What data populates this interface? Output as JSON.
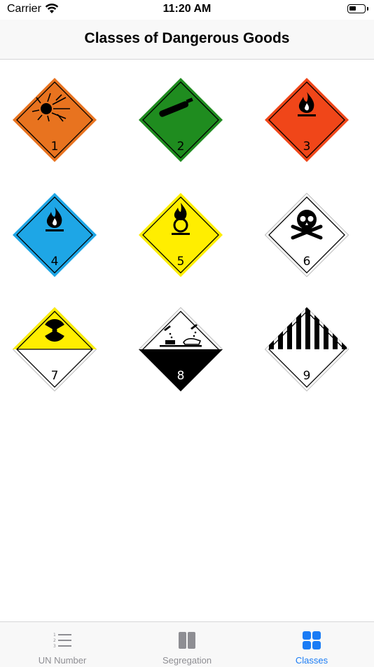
{
  "status_bar": {
    "carrier": "Carrier",
    "time": "11:20 AM"
  },
  "nav": {
    "title": "Classes of Dangerous Goods"
  },
  "classes": [
    {
      "number": "1",
      "color": "#e8731f",
      "symbol": "exploding-bomb-icon"
    },
    {
      "number": "2",
      "color": "#1f8c1f",
      "symbol": "gas-cylinder-icon"
    },
    {
      "number": "3",
      "color": "#f04619",
      "symbol": "flame-icon"
    },
    {
      "number": "4",
      "color": "#1ea6e6",
      "symbol": "flame-icon"
    },
    {
      "number": "5",
      "color": "#ffee00",
      "symbol": "flame-over-circle-icon"
    },
    {
      "number": "6",
      "color": "#ffffff",
      "symbol": "skull-crossbones-icon"
    },
    {
      "number": "7",
      "color": "#ffee00",
      "symbol": "radiation-trefoil-icon"
    },
    {
      "number": "8",
      "color": "#000000",
      "symbol": "corrosion-icon"
    },
    {
      "number": "9",
      "color": "#ffffff",
      "symbol": "stripes-icon"
    }
  ],
  "tabs": [
    {
      "label": "UN Number",
      "icon": "numbered-list-icon",
      "active": false
    },
    {
      "label": "Segregation",
      "icon": "columns-icon",
      "active": false
    },
    {
      "label": "Classes",
      "icon": "grid-icon",
      "active": true
    }
  ],
  "colors": {
    "accent": "#1a7cf5",
    "inactive": "#8e8e93"
  }
}
